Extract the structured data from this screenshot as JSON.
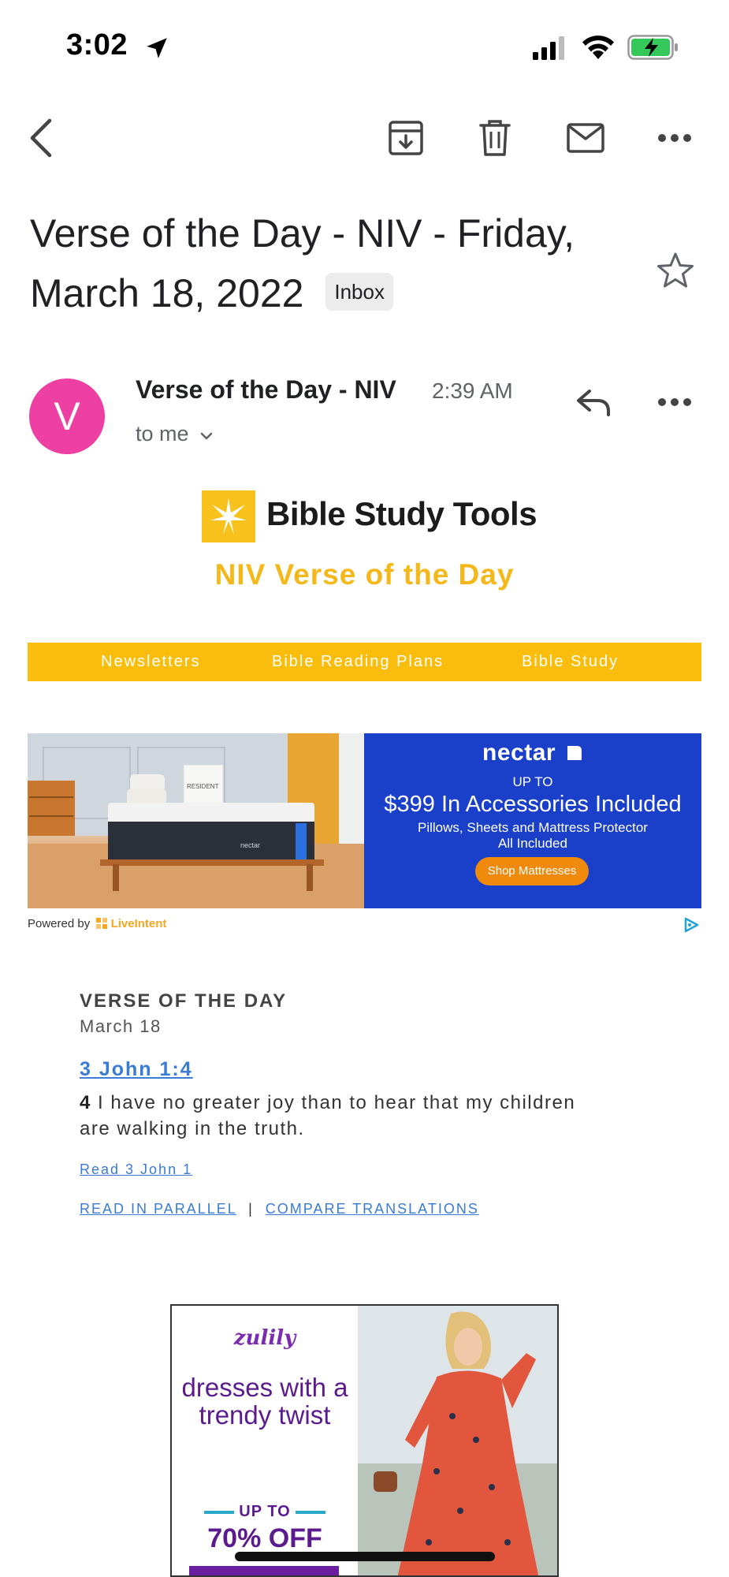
{
  "status_bar": {
    "time": "3:02"
  },
  "toolbar": {
    "back": "back",
    "archive": "archive",
    "delete": "delete",
    "mark_unread": "mark unread",
    "more": "more"
  },
  "email": {
    "subject": "Verse of the Day - NIV - Friday, March 18, 2022",
    "label": "Inbox",
    "sender_initial": "V",
    "sender_name": "Verse of the Day - NIV",
    "time": "2:39 AM",
    "recipient": "to me"
  },
  "newsletter": {
    "brand": "Bible Study Tools",
    "title": "NIV Verse of the Day",
    "nav": [
      "Newsletters",
      "Bible Reading Plans",
      "Bible Study"
    ]
  },
  "ad_top": {
    "brand": "nectar",
    "up_to": "UP TO",
    "headline": "$399 In Accessories Included",
    "sub_line1": "Pillows, Sheets and Mattress Protector",
    "sub_line2": "All Included",
    "cta": "Shop Mattresses",
    "box_label": "RESIDENT",
    "bed_label": "nectar",
    "powered_by": "Powered by",
    "provider": "LiveIntent"
  },
  "verse": {
    "heading": "VERSE OF THE DAY",
    "date": "March 18",
    "reference": "3 John 1:4",
    "verse_number": "4",
    "text": "I have no greater joy than to hear that my children are walking in the truth.",
    "read_chapter": "Read 3 John 1",
    "read_parallel": "READ IN PARALLEL",
    "separator": "|",
    "compare": "COMPARE TRANSLATIONS"
  },
  "ad_bottom": {
    "brand": "zulily",
    "tagline": "dresses with a trendy twist",
    "up_to": "UP TO",
    "discount": "70% OFF"
  },
  "colors": {
    "avatar": "#ee3fa3",
    "brand_yellow": "#fbbd0b",
    "link_blue": "#3a7bd5",
    "nectar_blue": "#1a3fc9",
    "zulily_purple": "#5b1b8e"
  }
}
